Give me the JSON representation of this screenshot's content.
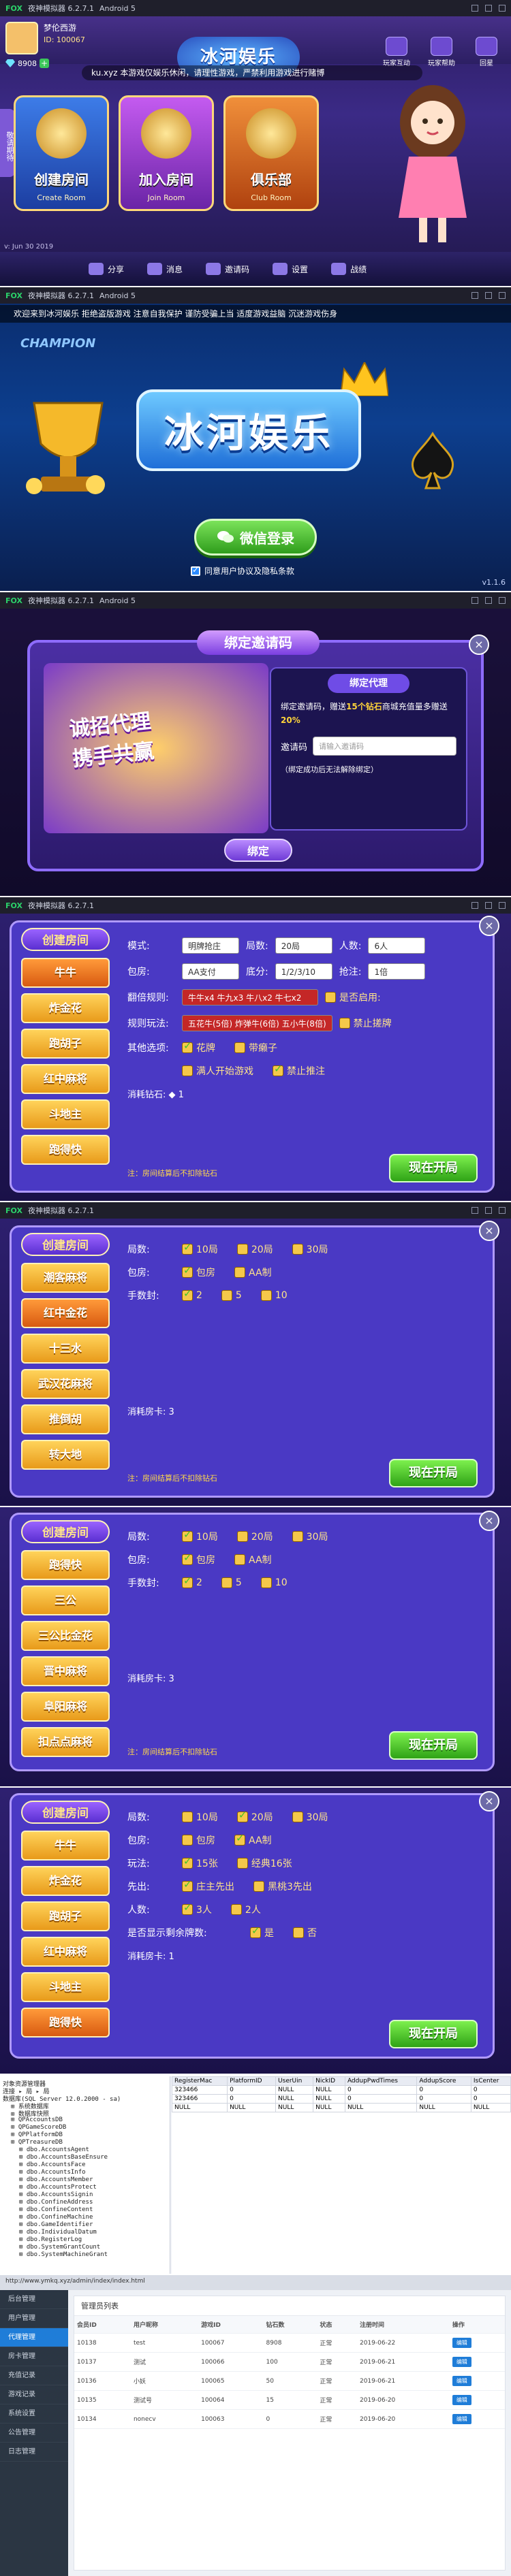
{
  "emulator": {
    "brand": "FOX",
    "title": "夜神模拟器 6.2.7.1",
    "android": "Android 5"
  },
  "lobby": {
    "player_name": "梦伦西游",
    "player_id": "ID: 100067",
    "diamonds": "8908",
    "logo": "冰河娱乐",
    "top_icons": [
      {
        "label": "玩家互动"
      },
      {
        "label": "玩家帮助"
      },
      {
        "label": "回星"
      }
    ],
    "marquee": "ku.xyz  本游戏仅娱乐休闲，请理性游戏，严禁利用游戏进行赌博",
    "side_tab": "敬请期待",
    "cards": [
      {
        "title": "创建房间",
        "sub": "Create Room"
      },
      {
        "title": "加入房间",
        "sub": "Join Room"
      },
      {
        "title": "俱乐部",
        "sub": "Club Room"
      }
    ],
    "bottom": [
      "分享",
      "消息",
      "邀请码",
      "设置",
      "战绩"
    ],
    "version": "v: Jun 30 2019"
  },
  "login": {
    "marquee": "欢迎来到冰河娱乐    拒绝盗版游戏    注意自我保护    谨防受骗上当    适度游戏益脑    沉迷游戏伤身",
    "champion": "CHAMPION",
    "logo": "冰河娱乐",
    "wechat": "微信登录",
    "agree": "同意用户协议及隐私条款",
    "version": "v1.1.6"
  },
  "bind": {
    "title": "绑定邀请码",
    "slogan_1": "诚招代理",
    "slogan_2": "携手共赢",
    "panel_title": "绑定代理",
    "desc_1": "绑定邀请码，赠送",
    "desc_hl_1": "15个钻石",
    "desc_2": "商城充值量多赠送",
    "desc_hl_2": "20%",
    "code_label": "邀请码",
    "code_placeholder": "请输入邀请码",
    "note": "（绑定成功后无法解除绑定）",
    "btn": "绑定",
    "close": "×"
  },
  "room1": {
    "title": "创建房间",
    "games": [
      "牛牛",
      "炸金花",
      "跑胡子",
      "红中麻将",
      "斗地主",
      "跑得快"
    ],
    "selected": 0,
    "rows": [
      {
        "label": "模式:",
        "sels": [
          "明牌抢庄"
        ],
        "extra": [
          {
            "label": "局数:",
            "value": "20局"
          },
          {
            "label": "人数:",
            "value": "6人"
          }
        ]
      },
      {
        "label": "包房:",
        "sels": [
          "AA支付"
        ],
        "extra": [
          {
            "label": "底分:",
            "value": "1/2/3/10"
          },
          {
            "label": "抢注:",
            "value": "1倍"
          }
        ]
      }
    ],
    "rule1_label": "翻倍规则:",
    "rule1_value": "牛牛x4 牛九x3 牛八x2 牛七x2",
    "rule1_opt": "是否启用:",
    "rule2_label": "规则玩法:",
    "rule2_value": "五花牛(5倍) 炸弹牛(6倍) 五小牛(8倍)",
    "rule2_opt": "禁止搓牌",
    "other_label": "其他选项:",
    "other_opts": [
      "花牌",
      "带癞子",
      "满人开始游戏",
      "禁止推注"
    ],
    "cost_label": "消耗钻石:",
    "cost_value": "1",
    "note": "注：房间结算后不扣除钻石",
    "start": "现在开局"
  },
  "room2": {
    "title": "创建房间",
    "games": [
      "潮客麻将",
      "红中金花",
      "十三水",
      "武汉花麻将",
      "推倒胡",
      "转大地"
    ],
    "rounds_label": "局数:",
    "rounds": [
      "10局",
      "20局",
      "30局"
    ],
    "room_label": "包房:",
    "room_opts": [
      "包房",
      "AA制"
    ],
    "hand_label": "手数封:",
    "hand_opts": [
      "2",
      "5",
      "10"
    ],
    "cost_label": "消耗房卡:",
    "cost_value": "3",
    "note": "注：房间结算后不扣除钻石",
    "start": "现在开局"
  },
  "room3": {
    "title": "创建房间",
    "games": [
      "跑得快",
      "三公",
      "三公比金花",
      "晋中麻将",
      "阜阳麻将",
      "扣点点麻将"
    ],
    "rounds_label": "局数:",
    "rounds": [
      "10局",
      "20局",
      "30局"
    ],
    "room_label": "包房:",
    "room_opts": [
      "包房",
      "AA制"
    ],
    "hand_label": "手数封:",
    "hand_opts": [
      "2",
      "5",
      "10"
    ],
    "cost_label": "消耗房卡:",
    "cost_value": "3",
    "note": "注：房间结算后不扣除钻石",
    "start": "现在开局"
  },
  "room4": {
    "title": "创建房间",
    "games": [
      "牛牛",
      "炸金花",
      "跑胡子",
      "红中麻将",
      "斗地主",
      "跑得快"
    ],
    "rows": [
      {
        "label": "局数:",
        "opts": [
          "10局",
          "20局",
          "30局"
        ],
        "on": [
          false,
          true,
          false
        ]
      },
      {
        "label": "包房:",
        "opts": [
          "包房",
          "AA制"
        ],
        "on": [
          false,
          true
        ]
      },
      {
        "label": "玩法:",
        "opts": [
          "15张",
          "经典16张"
        ],
        "on": [
          true,
          false
        ]
      },
      {
        "label": "先出:",
        "opts": [
          "庄主先出",
          "黑桃3先出"
        ],
        "on": [
          true,
          false
        ]
      },
      {
        "label": "人数:",
        "opts": [
          "3人",
          "2人"
        ],
        "on": [
          true,
          false
        ]
      },
      {
        "label": "是否显示剩余牌数:",
        "opts": [
          "是",
          "否"
        ],
        "on": [
          true,
          false
        ]
      }
    ],
    "cost_label": "消耗房卡:",
    "cost_value": "1",
    "start": "现在开局"
  },
  "db": {
    "tree": [
      "对象资源管理器",
      "连接 ▸ 局 ▸ 局",
      "数据库(SQL Server 12.0.2000 - sa)",
      "系统数据库",
      "数据库快照",
      "QPAccountsDB",
      "QPGameScoreDB",
      "QPPlatformDB",
      "QPTreasureDB",
      "dbo.AccountsAgent",
      "dbo.AccountsBaseEnsure",
      "dbo.AccountsFace",
      "dbo.AccountsInfo",
      "dbo.AccountsMember",
      "dbo.AccountsProtect",
      "dbo.AccountsSignin",
      "dbo.ConfineAddress",
      "dbo.ConfineContent",
      "dbo.ConfineMachine",
      "dbo.GameIdentifier",
      "dbo.IndividualDatum",
      "dbo.RegisterLog",
      "dbo.SystemGrantCount",
      "dbo.SystemMachineGrant"
    ],
    "columns": [
      "RegisterMac",
      "PlatformID",
      "UserUin",
      "NickID",
      "AddupPwdTimes",
      "AddupScore",
      "IsCenter"
    ],
    "rows": [
      [
        "323466",
        "0",
        "NULL",
        "NULL",
        "0",
        "0",
        "0"
      ],
      [
        "323466",
        "0",
        "NULL",
        "NULL",
        "0",
        "0",
        "0"
      ],
      [
        "NULL",
        "NULL",
        "NULL",
        "NULL",
        "NULL",
        "NULL",
        "NULL"
      ]
    ]
  },
  "admin": {
    "url": "http://www.ymkq.xyz/admin/index/index.html",
    "side": [
      "后台管理",
      "用户管理",
      "代理管理",
      "房卡管理",
      "充值记录",
      "游戏记录",
      "系统设置",
      "公告管理",
      "日志管理"
    ],
    "active": 2,
    "title": "管理员列表",
    "columns": [
      "会员ID",
      "用户昵称",
      "游戏ID",
      "钻石数",
      "状态",
      "注册时间",
      "操作"
    ],
    "rows": [
      [
        "10138",
        "test",
        "100067",
        "8908",
        "正常",
        "2019-06-22",
        "编辑"
      ],
      [
        "10137",
        "测试",
        "100066",
        "100",
        "正常",
        "2019-06-21",
        "编辑"
      ],
      [
        "10136",
        "小妖",
        "100065",
        "50",
        "正常",
        "2019-06-21",
        "编辑"
      ],
      [
        "10135",
        "测试号",
        "100064",
        "15",
        "正常",
        "2019-06-20",
        "编辑"
      ],
      [
        "10134",
        "nonecv",
        "100063",
        "0",
        "正常",
        "2019-06-20",
        "编辑"
      ]
    ]
  }
}
